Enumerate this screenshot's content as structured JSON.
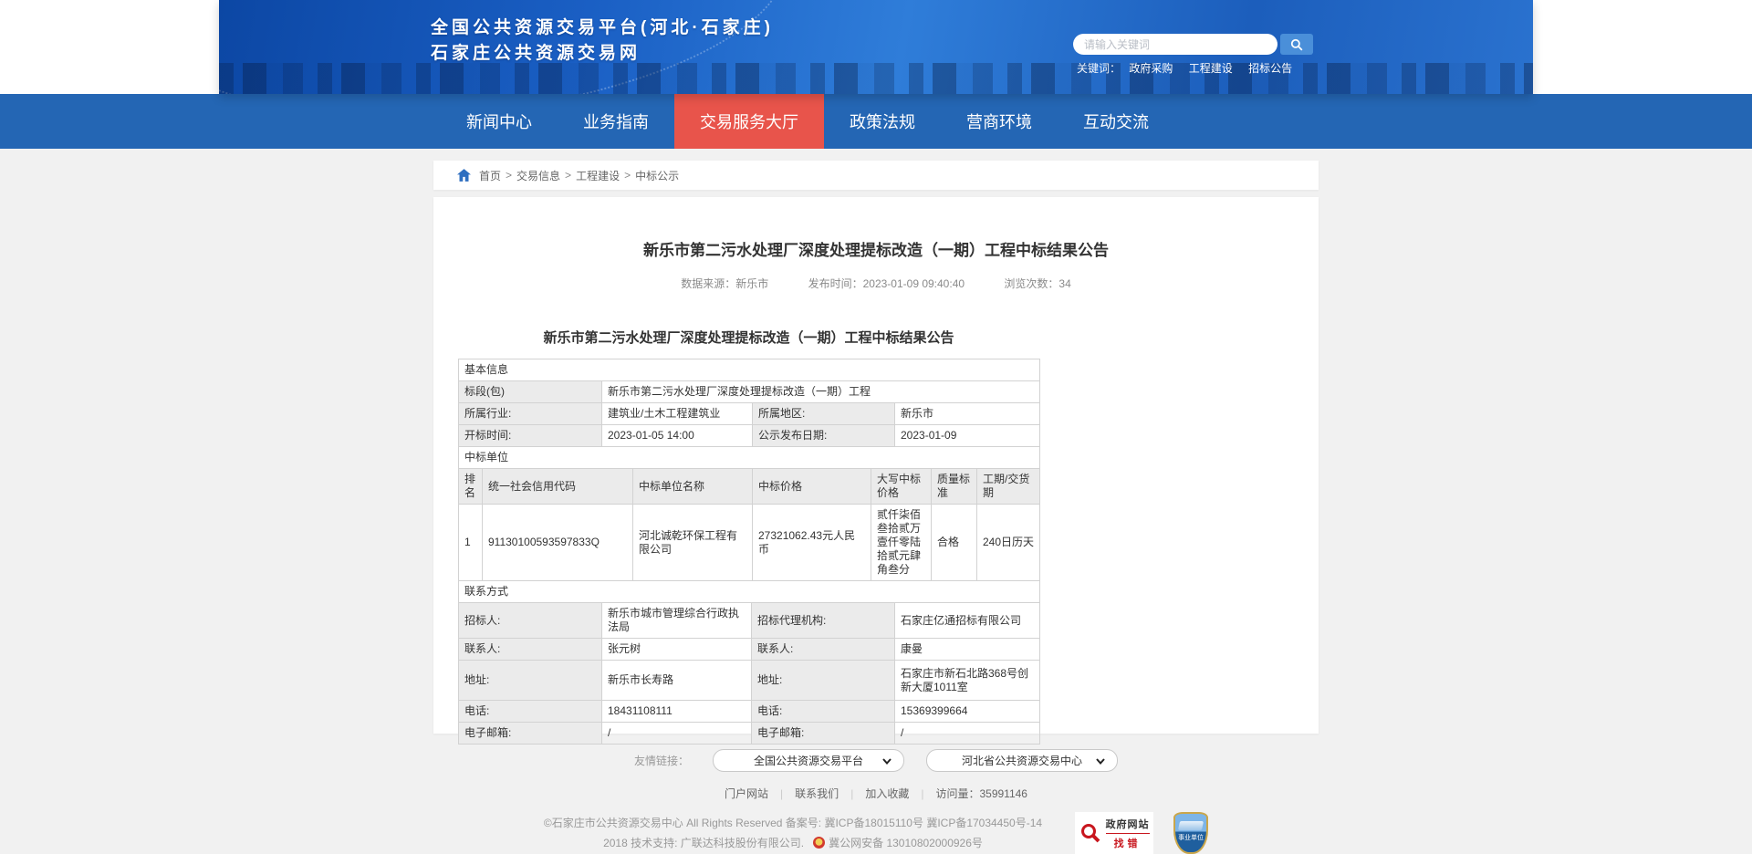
{
  "colors": {
    "banner_blue": "#1a5fc4",
    "nav_blue": "#2466b4",
    "active_red": "#e8544b",
    "search_button_blue": "#4a8fd9",
    "link_blue": "#2e6fc0",
    "label_cell_gray": "#ebebeb"
  },
  "header": {
    "site_title_line1": "全国公共资源交易平台(河北·石家庄)",
    "site_title_line2": "石家庄公共资源交易网",
    "search_placeholder": "请输入关键词",
    "keywords_label": "关键词：",
    "keywords": [
      "政府采购",
      "工程建设",
      "招标公告"
    ]
  },
  "nav": {
    "items": [
      {
        "label": "新闻中心",
        "active": false
      },
      {
        "label": "业务指南",
        "active": false
      },
      {
        "label": "交易服务大厅",
        "active": true
      },
      {
        "label": "政策法规",
        "active": false
      },
      {
        "label": "营商环境",
        "active": false
      },
      {
        "label": "互动交流",
        "active": false
      }
    ]
  },
  "breadcrumb": {
    "separator": ">",
    "items": [
      "首页",
      "交易信息",
      "工程建设",
      "中标公示"
    ]
  },
  "article": {
    "title": "新乐市第二污水处理厂深度处理提标改造（一期）工程中标结果公告",
    "meta": {
      "source_label": "数据来源：",
      "source": "新乐市",
      "time_label": "发布时间：",
      "time": "2023-01-09 09:40:40",
      "views_label": "浏览次数：",
      "views": "34"
    },
    "inner_title": "新乐市第二污水处理厂深度处理提标改造（一期）工程中标结果公告"
  },
  "table": {
    "basic": {
      "section": "基本信息",
      "package_label": "标段(包)",
      "package_value": "新乐市第二污水处理厂深度处理提标改造（一期）工程",
      "industry_label": "所属行业:",
      "industry_value": "建筑业/土木工程建筑业",
      "region_label": "所属地区:",
      "region_value": "新乐市",
      "open_time_label": "开标时间:",
      "open_time_value": "2023-01-05 14:00",
      "publish_date_label": "公示发布日期:",
      "publish_date_value": "2023-01-09"
    },
    "winner": {
      "section": "中标单位",
      "headers": [
        "排名",
        "统一社会信用代码",
        "中标单位名称",
        "中标价格",
        "大写中标价格",
        "质量标准",
        "工期/交货期"
      ],
      "rows": [
        [
          "1",
          "91130100593597833Q",
          "河北诚乾环保工程有限公司",
          "27321062.43元人民币",
          "贰仟柒佰叁拾贰万壹仟零陆拾贰元肆角叁分",
          "合格",
          "240日历天"
        ]
      ]
    },
    "contact": {
      "section": "联系方式",
      "rows": [
        {
          "l1": "招标人:",
          "v1": "新乐市城市管理综合行政执法局",
          "l2": "招标代理机构:",
          "v2": "石家庄亿通招标有限公司"
        },
        {
          "l1": "联系人:",
          "v1": "张元树",
          "l2": "联系人:",
          "v2": "康曼"
        },
        {
          "l1": "地址:",
          "v1": "新乐市长寿路",
          "l2": "地址:",
          "v2": "石家庄市新石北路368号创新大厦1011室"
        },
        {
          "l1": "电话:",
          "v1": "18431108111",
          "l2": "电话:",
          "v2": "15369399664"
        },
        {
          "l1": "电子邮箱:",
          "v1": "/",
          "l2": "电子邮箱:",
          "v2": "/"
        }
      ]
    }
  },
  "footer": {
    "links_label": "友情链接：",
    "dropdowns": [
      {
        "value": "全国公共资源交易平台"
      },
      {
        "value": "河北省公共资源交易中心"
      }
    ],
    "links": [
      "门户网站",
      "联系我们",
      "加入收藏"
    ],
    "visits_label": "访问量：",
    "visits": "35991146",
    "copyright_line1": "©石家庄市公共资源交易中心 All Rights Reserved 备案号: 冀ICP备18015110号 冀ICP备17034450号-14",
    "copyright_line2": "2018 技术支持: 广联达科技股份有限公司.",
    "security_text": "冀公网安备 13010802000926号",
    "badge_find_error": {
      "line1": "政府网站",
      "line2": "找错"
    },
    "badge_institution": "事业单位"
  }
}
